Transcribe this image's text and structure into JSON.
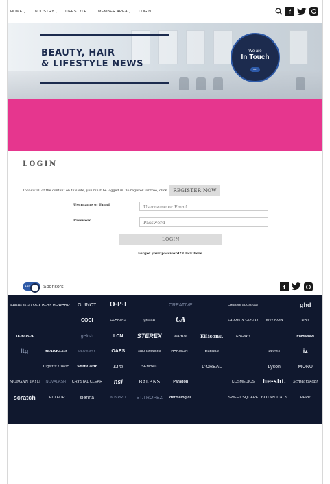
{
  "nav": {
    "items": [
      {
        "label": "HOME",
        "dropdown": true
      },
      {
        "label": "INDUSTRY",
        "dropdown": true
      },
      {
        "label": "LIFESTYLE",
        "dropdown": true
      },
      {
        "label": "MEMBER AREA",
        "dropdown": true
      },
      {
        "label": "LOGIN",
        "dropdown": false
      }
    ],
    "icons": [
      "search-icon",
      "facebook-icon",
      "twitter-icon",
      "instagram-icon"
    ]
  },
  "hero": {
    "title_line1": "BEAUTY, HAIR",
    "title_line2": "& LIFESTYLE NEWS",
    "badge_line1": "We are",
    "badge_line2": "In Touch",
    "badge_logo": "ABT"
  },
  "colors": {
    "navy": "#1c2b4e",
    "pink": "#e6368e",
    "blue": "#2e5aa8"
  },
  "login": {
    "title": "LOGIN",
    "notice": "To view all of the content on this site, you must be logged in. To register for free, click",
    "register_label": "REGISTER NOW",
    "username_label": "Username or Email",
    "username_placeholder": "Username or Email",
    "password_label": "Password",
    "password_placeholder": "Password",
    "submit_label": "LOGIN",
    "forgot_text": "Forgot your password? Click here"
  },
  "sponsors": {
    "badge": "ABT",
    "title": "Sponsors",
    "logos": [
      "adams & STOCK WAX",
      "ALAN HOWARD",
      "GUINOT",
      "O·P·I",
      "",
      "CREATIVE",
      "",
      "creative apostrophe",
      "",
      "ghd",
      "",
      "",
      "COCI",
      "CLARINS",
      "gelish",
      "CA",
      "",
      "CROWN COUTURE",
      "ENVIRON",
      "DRY",
      "JESSICA",
      "",
      "gelish",
      "LCN",
      "STEREX",
      "SHARP",
      "Ellisons.",
      "CROWN",
      "",
      "FakeBake",
      "ltg",
      "SPARKLES",
      "BLUESKY",
      "OAES",
      "salonservices",
      "HARMONY",
      "ELEMIS",
      "",
      "brows",
      "iz",
      "",
      "Crystal Clear",
      "ShinGuar",
      "Kim",
      "SEMBAC",
      "",
      "L'ORÉAL",
      "",
      "Lycon",
      "MONU",
      "MORGAN TAYLOR",
      "NOVALASH",
      "CRYSTAL CLEAR",
      "nsi",
      "BALENS",
      "Paragon",
      "",
      "COSMEDICS",
      "he-shi.",
      "Schwarzkopf",
      "scratch",
      "DECLÉOR",
      "sienna",
      "K B PRO",
      "ST.TROPEZ",
      "dermalogica",
      "",
      "SWEET SQUARED",
      "BOTANICALS",
      "PPPP"
    ]
  }
}
